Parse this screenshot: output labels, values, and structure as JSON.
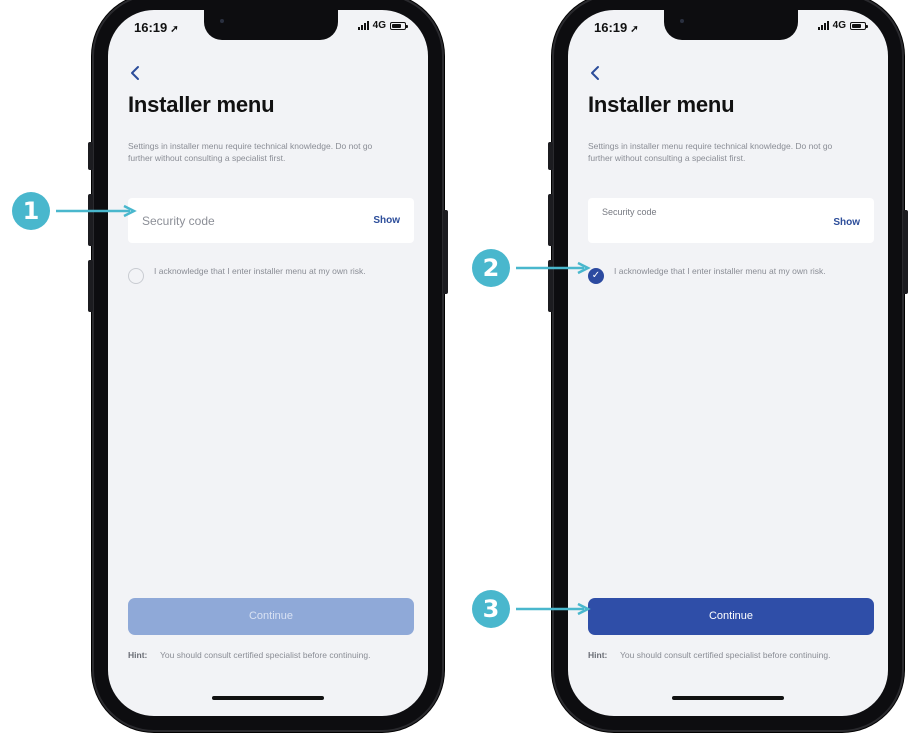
{
  "status": {
    "time": "16:19",
    "location_icon": "navigation-arrow-icon",
    "network": "4G"
  },
  "screen": {
    "title": "Installer menu",
    "description": "Settings in installer menu require technical knowledge. Do not go further without consulting a specialist first.",
    "security_code_placeholder": "Security code",
    "show_label": "Show",
    "acknowledge_text": "I acknowledge that I enter installer menu at my own risk.",
    "continue_label": "Continue",
    "hint_label": "Hint:",
    "hint_text": "You should consult certified specialist before continuing."
  },
  "left_phone": {
    "acknowledge_checked": false,
    "continue_enabled": false
  },
  "right_phone": {
    "acknowledge_checked": true,
    "continue_enabled": true
  },
  "callouts": [
    "1",
    "2",
    "3"
  ],
  "colors": {
    "accent": "#2f4ea8",
    "accent_disabled": "#8fa9d8",
    "callout": "#49b7cd",
    "screen_bg": "#f2f3f6"
  }
}
